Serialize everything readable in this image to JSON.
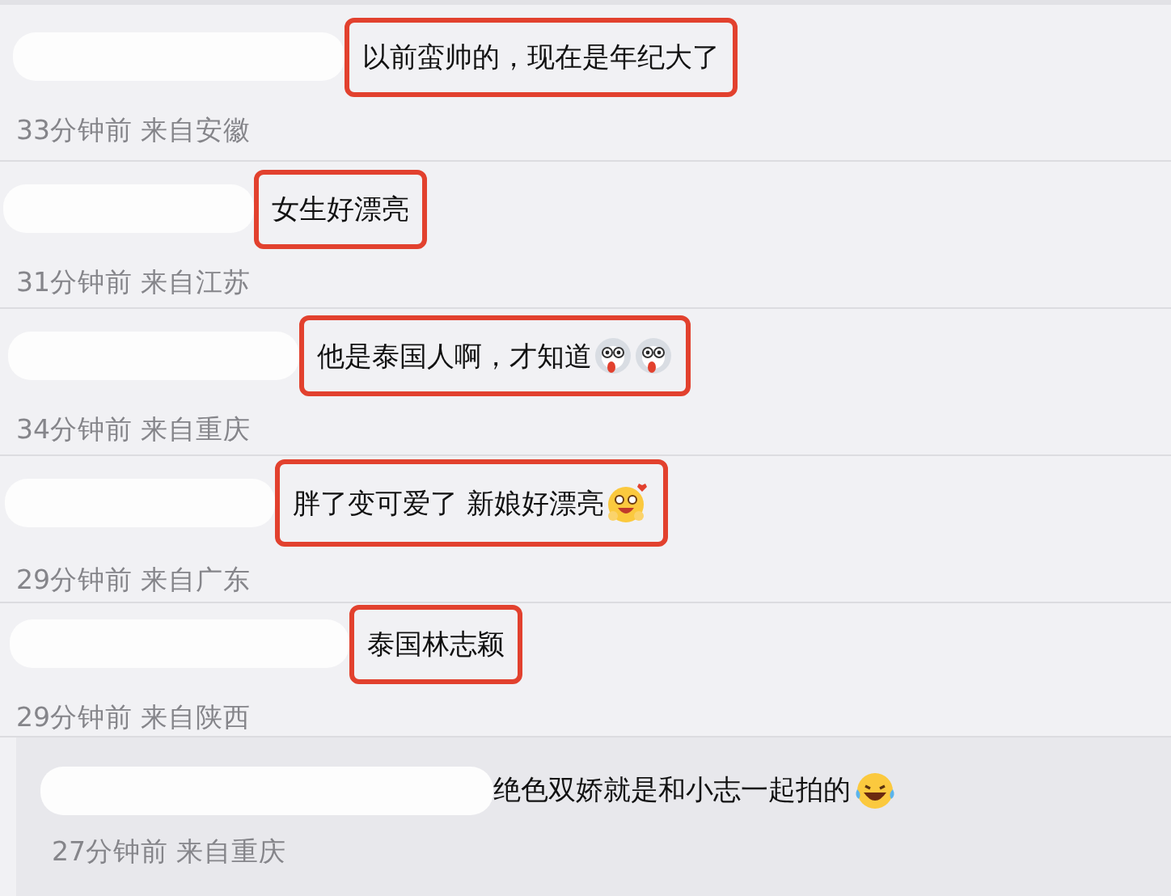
{
  "comments": [
    {
      "text": "以前蛮帅的，现在是年纪大了",
      "highlighted": true,
      "meta": "33分钟前 来自安徽"
    },
    {
      "text": "女生好漂亮",
      "highlighted": true,
      "meta": "31分钟前 来自江苏"
    },
    {
      "text": "他是泰国人啊，才知道",
      "emojis": [
        {
          "kind": "dog"
        },
        {
          "kind": "dog"
        }
      ],
      "highlighted": true,
      "meta": "34分钟前 来自重庆"
    },
    {
      "text": "胖了变可爱了 新娘好漂亮",
      "emojis": [
        {
          "kind": "blush"
        }
      ],
      "highlighted": true,
      "meta": "29分钟前 来自广东"
    },
    {
      "text": "泰国林志颖",
      "highlighted": true,
      "meta": "29分钟前 来自陕西"
    }
  ],
  "reply": {
    "text": "绝色双娇就是和小志一起拍的",
    "emojis": [
      {
        "kind": "laugh"
      }
    ],
    "highlighted": false,
    "meta": "27分钟前 来自重庆"
  }
}
